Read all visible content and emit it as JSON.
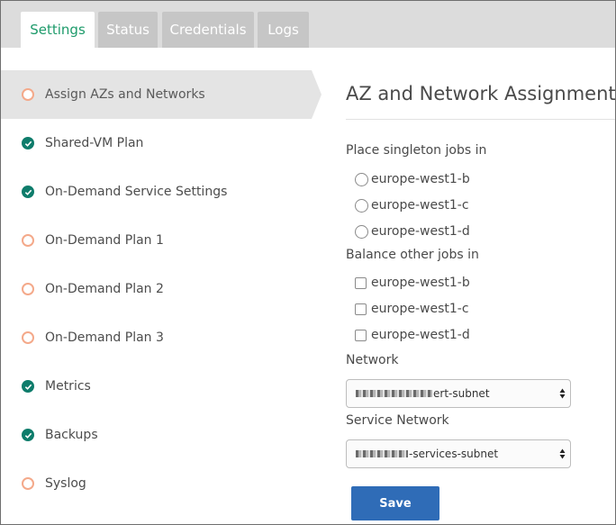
{
  "tabs": [
    {
      "label": "Settings",
      "active": true
    },
    {
      "label": "Status",
      "active": false
    },
    {
      "label": "Credentials",
      "active": false
    },
    {
      "label": "Logs",
      "active": false
    }
  ],
  "sidebar": {
    "items": [
      {
        "label": "Assign AZs and Networks",
        "status": "incomplete",
        "active": true
      },
      {
        "label": "Shared-VM Plan",
        "status": "complete"
      },
      {
        "label": "On-Demand Service Settings",
        "status": "complete"
      },
      {
        "label": "On-Demand Plan 1",
        "status": "incomplete"
      },
      {
        "label": "On-Demand Plan 2",
        "status": "incomplete"
      },
      {
        "label": "On-Demand Plan 3",
        "status": "incomplete"
      },
      {
        "label": "Metrics",
        "status": "complete"
      },
      {
        "label": "Backups",
        "status": "complete"
      },
      {
        "label": "Syslog",
        "status": "incomplete"
      }
    ]
  },
  "form": {
    "title": "AZ and Network Assignments",
    "singleton": {
      "label": "Place singleton jobs in",
      "options": [
        "europe-west1-b",
        "europe-west1-c",
        "europe-west1-d"
      ],
      "selected": null
    },
    "balance": {
      "label": "Balance other jobs in",
      "options": [
        "europe-west1-b",
        "europe-west1-c",
        "europe-west1-d"
      ],
      "checked": [
        false,
        false,
        false
      ]
    },
    "network": {
      "label": "Network",
      "value": "ert-subnet"
    },
    "service_network": {
      "label": "Service Network",
      "value": "-services-subnet"
    },
    "save_label": "Save"
  },
  "colors": {
    "accent_green": "#1e9b6b",
    "complete_icon": "#0e7c6b",
    "incomplete_icon": "#f4a98a",
    "save_button": "#2f6cb7",
    "active_nav_bg": "#e4e4e4"
  },
  "icons": {
    "complete": "check-circle-icon",
    "incomplete": "hollow-circle-icon",
    "select": "up-down-arrows-icon"
  }
}
